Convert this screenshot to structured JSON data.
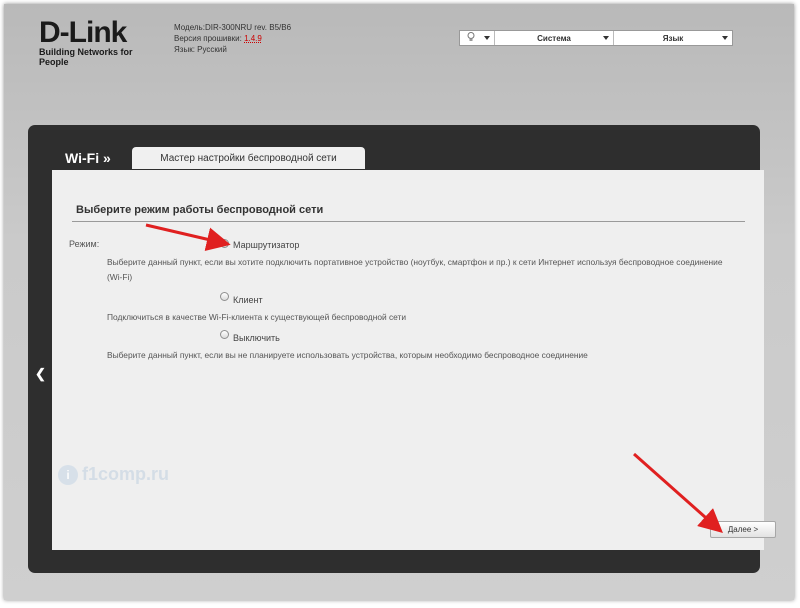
{
  "header": {
    "logo": "D-Link",
    "logo_tagline": "Building Networks for People",
    "model_label": "Модель:",
    "model_value": "DIR-300NRU rev. B5/B6",
    "firmware_label": "Версия прошивки:",
    "firmware_value": "1.4.9",
    "language_label": "Язык:",
    "language_value": "Русский"
  },
  "topmenu": {
    "lamp_icon": "lightbulb-icon",
    "system": "Система",
    "language": "Язык"
  },
  "panel": {
    "section": "Wi-Fi »",
    "tab": "Мастер настройки беспроводной сети",
    "title": "Выберите режим работы беспроводной сети",
    "mode_label": "Режим:",
    "options": [
      {
        "label": "Маршрутизатор",
        "checked": true,
        "desc": "Выберите данный пункт, если вы хотите подключить портативное устройство (ноутбук, смартфон и пр.) к сети Интернет используя беспроводное соединение (Wi-Fi)"
      },
      {
        "label": "Клиент",
        "checked": false,
        "desc": "Подключиться в качестве Wi-Fi-клиента к существующей беспроводной сети"
      },
      {
        "label": "Выключить",
        "checked": false,
        "desc": "Выберите данный пункт, если вы не планируете использовать устройства, которым необходимо беспроводное соединение"
      }
    ],
    "next_button": "Далее >",
    "back_icon": "chevron-left-icon"
  },
  "watermark": "f1comp.ru",
  "colors": {
    "accent_red": "#e02020",
    "panel_dark": "#2e2e2e",
    "content_bg": "#efefef"
  }
}
